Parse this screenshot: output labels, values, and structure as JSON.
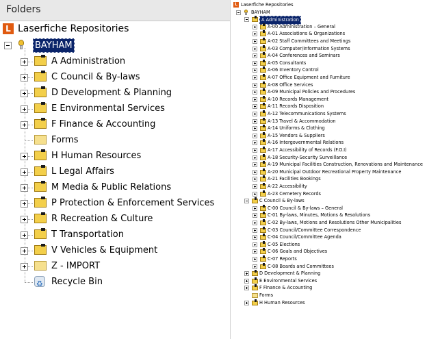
{
  "left_pane": {
    "header_title": "Folders",
    "root_label": "Laserfiche Repositories",
    "repository_label": "BAYHAM",
    "items": [
      {
        "label": "A Administration",
        "icon": "folder-labeled-icon",
        "expandable": true
      },
      {
        "label": "C Council & By-laws",
        "icon": "folder-labeled-icon",
        "expandable": true
      },
      {
        "label": "D Development & Planning",
        "icon": "folder-labeled-icon",
        "expandable": true
      },
      {
        "label": "E Environmental Services",
        "icon": "folder-labeled-icon",
        "expandable": true
      },
      {
        "label": "F Finance & Accounting",
        "icon": "folder-labeled-icon",
        "expandable": true
      },
      {
        "label": "Forms",
        "icon": "folder-icon",
        "expandable": false
      },
      {
        "label": "H Human Resources",
        "icon": "folder-labeled-icon",
        "expandable": true
      },
      {
        "label": "L Legal Affairs",
        "icon": "folder-labeled-icon",
        "expandable": true
      },
      {
        "label": "M Media & Public Relations",
        "icon": "folder-labeled-icon",
        "expandable": true
      },
      {
        "label": "P Protection & Enforcement Services",
        "icon": "folder-labeled-icon",
        "expandable": true
      },
      {
        "label": "R Recreation & Culture",
        "icon": "folder-labeled-icon",
        "expandable": true
      },
      {
        "label": "T Transportation",
        "icon": "folder-labeled-icon",
        "expandable": true
      },
      {
        "label": "V Vehicles & Equipment",
        "icon": "folder-labeled-icon",
        "expandable": true
      },
      {
        "label": "Z - IMPORT",
        "icon": "folder-icon",
        "expandable": true
      },
      {
        "label": "Recycle Bin",
        "icon": "recycle-bin-icon",
        "expandable": false
      }
    ]
  },
  "right_pane": {
    "root_label": "Laserfiche Repositories",
    "repository_label": "BAYHAM",
    "expanded_folder": "A Administration",
    "a_children": [
      "A-00 Administration – General",
      "A-01 Associations & Organizations",
      "A-02 Staff Committees and Meetings",
      "A-03 Computer/Information Systems",
      "A-04 Conferences and Seminars",
      "A-05 Consultants",
      "A-06 Inventory Control",
      "A-07 Office Equipment and Furniture",
      "A-08 Office Services",
      "A-09 Municipal Policies and Procedures",
      "A-10 Records Management",
      "A-11 Records Disposition",
      "A-12 Telecommunications Systems",
      "A-13 Travel & Accommodation",
      "A-14 Uniforms & Clothing",
      "A-15 Vendors & Suppliers",
      "A-16 Intergovernmental Relations",
      "A-17 Accessibility of Records (F.O.I)",
      "A-18 Security-Security Surveillance",
      "A-19 Municipal Facilities Construction, Renovations and Maintenance",
      "A-20 Municipal Outdoor Recreational Property Maintenance",
      "A-21 Facilities Bookings",
      "A-22 Accessibility",
      "A-23 Cemetery Records"
    ],
    "second_folder": "C Council & By-laws",
    "c_children": [
      "C-00 Council & By-laws – General",
      "C-01 By-laws, Minutes, Motions & Resolutions",
      "C-02 By-laws, Motions and Resolutions Other Municipalities",
      "C-03 Council/Committee Correspondence",
      "C-04 Council/Committee Agenda",
      "C-05 Elections",
      "C-06 Goals and Objectives",
      "C-07 Reports",
      "C-08 Boards and Committees"
    ],
    "tail_items": [
      {
        "label": "D Development & Planning",
        "plain": false
      },
      {
        "label": "E Environmental Services",
        "plain": false
      },
      {
        "label": "F Finance & Accounting",
        "plain": false
      },
      {
        "label": "Forms",
        "plain": true
      },
      {
        "label": "H Human Resources",
        "plain": false
      }
    ]
  },
  "colors": {
    "selection": "#0a246a",
    "folder": "#f3cf4a",
    "logo": "#e05a10",
    "header_bg": "#e8e8e8"
  }
}
